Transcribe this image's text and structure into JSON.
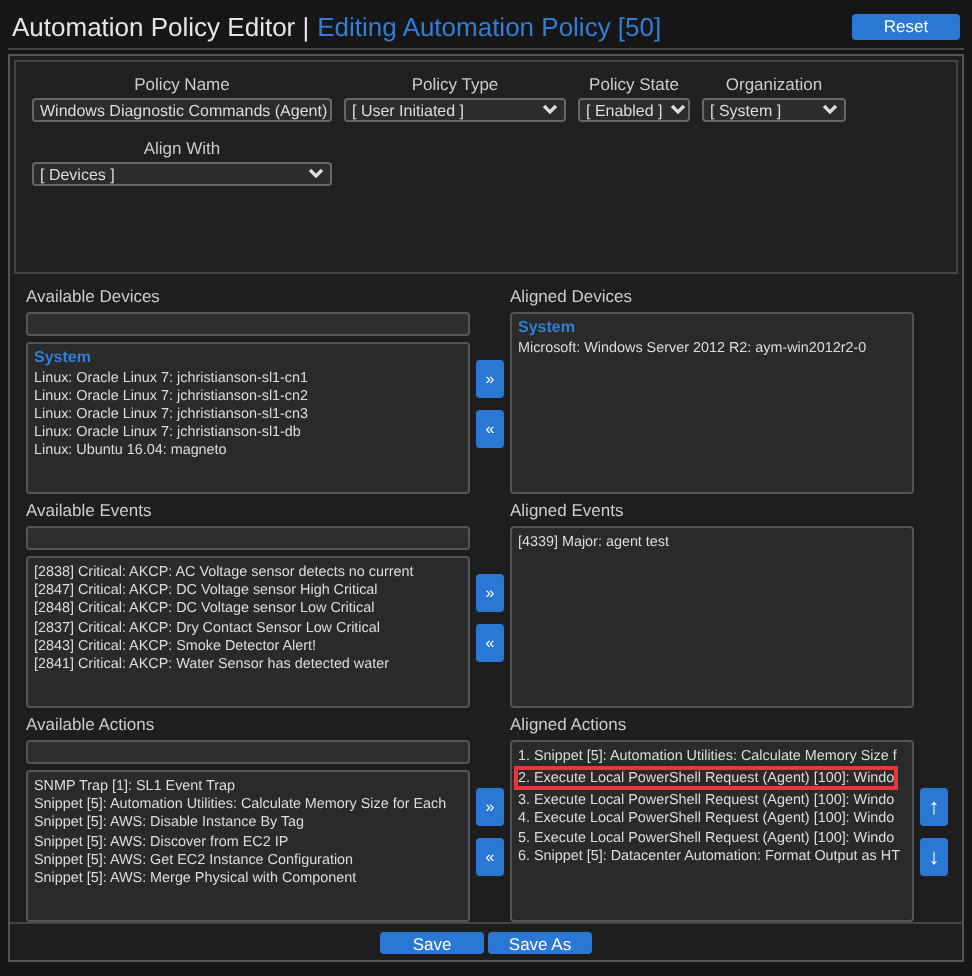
{
  "header": {
    "title": "Automation Policy Editor |",
    "subtitle": "Editing Automation Policy [50]",
    "reset_button": "Reset"
  },
  "form": {
    "rows": [
      [
        {
          "kind": "text",
          "label": "Policy Name",
          "value": "Windows Diagnostic Commands (Agent)"
        },
        {
          "kind": "select",
          "label": "Policy Type",
          "value": "[ User Initiated ]"
        },
        {
          "kind": "select",
          "label": "Policy State",
          "value": "[ Enabled ]"
        },
        {
          "kind": "select",
          "label": "Organization",
          "value": "[ System ]"
        }
      ],
      [
        {
          "kind": "select",
          "label": "Align With",
          "value": "[ Devices ]"
        }
      ]
    ]
  },
  "sections": [
    {
      "available": {
        "title": "Available Devices",
        "group": "System",
        "items": [
          {
            "text": "Linux: Oracle Linux 7: jchristianson-sl1-cn1",
            "highlighted": false
          },
          {
            "text": "Linux: Oracle Linux 7: jchristianson-sl1-cn2",
            "highlighted": false
          },
          {
            "text": "Linux: Oracle Linux 7: jchristianson-sl1-cn3",
            "highlighted": false
          },
          {
            "text": "Linux: Oracle Linux 7: jchristianson-sl1-db",
            "highlighted": false
          },
          {
            "text": "Linux: Ubuntu 16.04: magneto",
            "highlighted": false
          }
        ]
      },
      "move_right": "»",
      "move_left": "«",
      "aligned": {
        "title": "Aligned Devices",
        "group": "System",
        "items": [
          {
            "text": "Microsoft: Windows Server 2012 R2: aym-win2012r2-0",
            "highlighted": false
          }
        ]
      }
    },
    {
      "available": {
        "title": "Available Events",
        "items": [
          {
            "text": "[2838] Critical: AKCP: AC Voltage sensor detects no current",
            "highlighted": false
          },
          {
            "text": "[2847] Critical: AKCP: DC Voltage sensor High Critical",
            "highlighted": false
          },
          {
            "text": "[2848] Critical: AKCP: DC Voltage sensor Low Critical",
            "highlighted": false
          },
          {
            "text": "[2837] Critical: AKCP: Dry Contact Sensor Low Critical",
            "highlighted": false
          },
          {
            "text": "[2843] Critical: AKCP: Smoke Detector Alert!",
            "highlighted": false
          },
          {
            "text": "[2841] Critical: AKCP: Water Sensor has detected water",
            "highlighted": false
          }
        ]
      },
      "move_right": "»",
      "move_left": "«",
      "aligned": {
        "title": "Aligned Events",
        "items": [
          {
            "text": "[4339] Major: agent test",
            "highlighted": false
          }
        ]
      }
    },
    {
      "available": {
        "title": "Available Actions",
        "items": [
          {
            "text": "SNMP Trap [1]: SL1 Event Trap",
            "highlighted": false
          },
          {
            "text": "Snippet [5]: Automation Utilities: Calculate Memory Size for Each",
            "highlighted": false
          },
          {
            "text": "Snippet [5]: AWS: Disable Instance By Tag",
            "highlighted": false
          },
          {
            "text": "Snippet [5]: AWS: Discover from EC2 IP",
            "highlighted": false
          },
          {
            "text": "Snippet [5]: AWS: Get EC2 Instance Configuration",
            "highlighted": false
          },
          {
            "text": "Snippet [5]: AWS: Merge Physical with Component",
            "highlighted": false
          }
        ]
      },
      "move_right": "»",
      "move_left": "«",
      "aligned": {
        "title": "Aligned Actions",
        "items": [
          {
            "text": "1. Snippet [5]: Automation Utilities: Calculate Memory Size f",
            "highlighted": false
          },
          {
            "text": "2. Execute Local PowerShell Request (Agent) [100]: Windo",
            "highlighted": true
          },
          {
            "text": "3. Execute Local PowerShell Request (Agent) [100]: Windo",
            "highlighted": false
          },
          {
            "text": "4. Execute Local PowerShell Request (Agent) [100]: Windo",
            "highlighted": false
          },
          {
            "text": "5. Execute Local PowerShell Request (Agent) [100]: Windo",
            "highlighted": false
          },
          {
            "text": "6. Snippet [5]: Datacenter Automation: Format Output as HT",
            "highlighted": false
          }
        ]
      },
      "order_buttons": [
        "↑",
        "↓"
      ]
    }
  ],
  "footer": {
    "buttons": [
      "Save",
      "Save As"
    ]
  }
}
